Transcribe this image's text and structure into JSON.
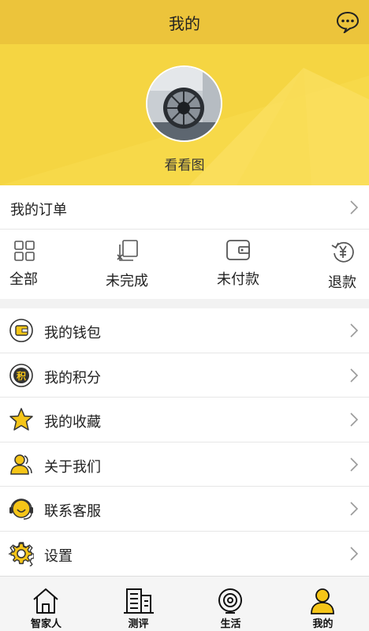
{
  "header": {
    "title": "我的",
    "message_icon": "chat-bubble-icon"
  },
  "profile": {
    "username": "看看图",
    "avatar": "avatar-photo"
  },
  "orders": {
    "title": "我的订单",
    "items": [
      {
        "label": "全部",
        "icon": "grid-icon"
      },
      {
        "label": "未完成",
        "icon": "incomplete-icon"
      },
      {
        "label": "未付款",
        "icon": "wallet-icon"
      },
      {
        "label": "退款",
        "icon": "refund-icon"
      }
    ]
  },
  "menu": [
    {
      "label": "我的钱包",
      "icon": "wallet-icon"
    },
    {
      "label": "我的积分",
      "icon": "points-icon",
      "icon_text": "积"
    },
    {
      "label": "我的收藏",
      "icon": "star-icon"
    },
    {
      "label": "关于我们",
      "icon": "people-icon"
    },
    {
      "label": "联系客服",
      "icon": "headset-icon"
    },
    {
      "label": "设置",
      "icon": "gear-icon"
    }
  ],
  "tabbar": [
    {
      "label": "智家人",
      "icon": "home-icon"
    },
    {
      "label": "测评",
      "icon": "building-icon"
    },
    {
      "label": "生活",
      "icon": "target-icon"
    },
    {
      "label": "我的",
      "icon": "person-icon",
      "active": true
    }
  ],
  "colors": {
    "accent": "#f7d949",
    "header": "#ecc43b",
    "icon_yellow": "#f5c518"
  }
}
